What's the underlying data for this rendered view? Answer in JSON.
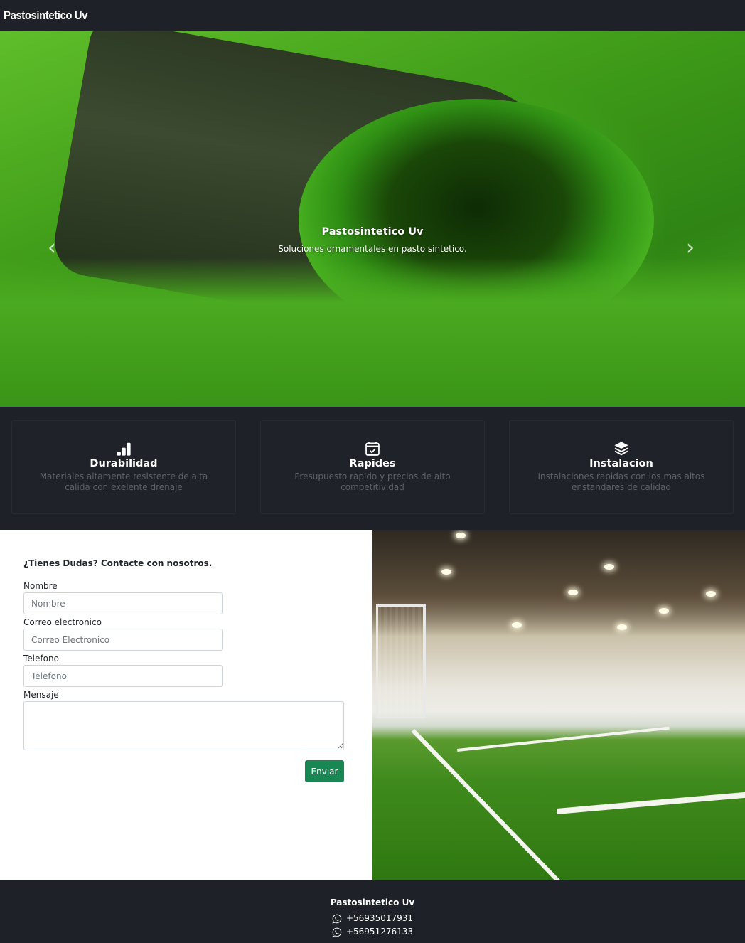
{
  "navbar": {
    "brand": "Pastosintetico Uv"
  },
  "hero": {
    "title": "Pastosintetico Uv",
    "subtitle": "Soluciones ornamentales en pasto sintetico.",
    "prev_icon": "chevron-left-icon",
    "next_icon": "chevron-right-icon"
  },
  "features": [
    {
      "icon": "bar-chart-icon",
      "title": "Durabilidad",
      "text": "Materiales altamente resistente de alta calida con exelente drenaje"
    },
    {
      "icon": "calendar-check-icon",
      "title": "Rapides",
      "text": "Presupuesto rapido y precios de alto competitividad"
    },
    {
      "icon": "layers-icon",
      "title": "Instalacion",
      "text": "Instalaciones rapidas con los mas altos enstandares de calidad"
    }
  ],
  "contact": {
    "heading": "¿Tienes Dudas? Contacte con nosotros.",
    "name_label": "Nombre",
    "name_placeholder": "Nombre",
    "email_label": "Correo electronico",
    "email_placeholder": "Correo Electronico",
    "phone_label": "Telefono",
    "phone_placeholder": "Telefono",
    "message_label": "Mensaje",
    "submit_label": "Enviar"
  },
  "footer": {
    "brand": "Pastosintetico Uv",
    "phones": [
      "+56935017931",
      "+56951276133"
    ],
    "phone_icon": "whatsapp-icon"
  },
  "colors": {
    "dark_bg": "#1e2127",
    "submit_green": "#198754",
    "muted_text": "#5c6168"
  }
}
